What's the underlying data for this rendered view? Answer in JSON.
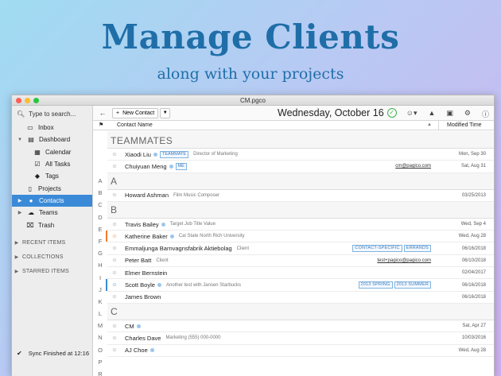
{
  "banner": {
    "title": "Manage Clients",
    "subtitle": "along with your projects"
  },
  "window": {
    "title": "CM.pgco"
  },
  "sidebar": {
    "search_label": "Type to search...",
    "items": [
      {
        "label": "Inbox"
      },
      {
        "label": "Dashboard"
      },
      {
        "label": "Calendar"
      },
      {
        "label": "All Tasks"
      },
      {
        "label": "Tags"
      },
      {
        "label": "Projects"
      },
      {
        "label": "Contacts"
      },
      {
        "label": "Teams"
      },
      {
        "label": "Trash"
      }
    ],
    "sections": [
      "RECENT ITEMS",
      "COLLECTIONS",
      "STARRED ITEMS"
    ],
    "sync_status": "Sync Finished at 12:16"
  },
  "toolbar": {
    "new_contact_label": "New Contact",
    "date": "Wednesday, October 16"
  },
  "columns": {
    "name": "Contact Name",
    "modified": "Modified Time"
  },
  "alpha_index": [
    "A",
    "B",
    "C",
    "D",
    "E",
    "F",
    "G",
    "H",
    "I",
    "J",
    "K",
    "L",
    "M",
    "N",
    "O",
    "P",
    "R"
  ],
  "groups": [
    {
      "label": "TEAMMATES",
      "rows": [
        {
          "name": "Xiaodi Liu",
          "tag": "TEAMMATE",
          "note": "Director of Marketing",
          "date": "Mon, Sep 30"
        },
        {
          "name": "Chuiyuan Meng",
          "tag": "ME",
          "email": "cm@pagico.com",
          "date": "Sat, Aug 31"
        }
      ]
    },
    {
      "label": "A",
      "rows": [
        {
          "name": "Howard Ashman",
          "note": "Film Music Composer",
          "date": "03/25/2013"
        }
      ]
    },
    {
      "label": "B",
      "rows": [
        {
          "name": "Travis Bailey",
          "note": "Target  Job Title Value",
          "date": "Wed, Sep 4"
        },
        {
          "name": "Katherine Baker",
          "note": "Cal State North Rich University",
          "date": "Wed, Aug 28"
        },
        {
          "name": "Emmaljunga Barnvagnsfabrik Aktiebolag",
          "note": "Client",
          "tags": [
            "CONTACT-SPECIFIC",
            "ERRANDS"
          ],
          "date": "06/16/2018"
        },
        {
          "name": "Peter Batt",
          "note": "Client",
          "email": "test+pagico@pagico.com",
          "date": "06/10/2018"
        },
        {
          "name": "Elmer Bernstein",
          "date": "02/04/2017"
        },
        {
          "name": "Scott Boyle",
          "note": "Another test with Jansen  Starbucks",
          "tags": [
            "2013 SPRING",
            "2013 SUMMER"
          ],
          "date": "06/16/2018"
        },
        {
          "name": "James Brown",
          "date": "06/16/2018"
        }
      ]
    },
    {
      "label": "C",
      "rows": [
        {
          "name": "CM",
          "date": "Sat, Apr 27"
        },
        {
          "name": "Charles Dave",
          "note": "Marketing  (555) 000-0000",
          "date": "10/03/2016"
        },
        {
          "name": "AJ Choe",
          "date": "Wed, Aug 28"
        }
      ]
    }
  ],
  "colors": {
    "accent": "#3b8ad8",
    "headline": "#1f6ea8",
    "success": "#3db34a",
    "flag_orange": "#f07a2a",
    "flag_blue": "#3b8ad8"
  }
}
